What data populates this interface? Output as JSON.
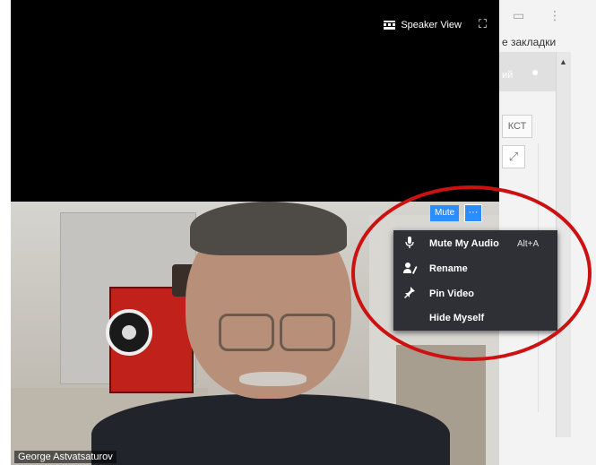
{
  "browser_background": {
    "bookmarks_text": "е закладки",
    "tab_text": "ий",
    "kst_text": "КСТ"
  },
  "top_bar": {
    "speaker_view_label": "Speaker View"
  },
  "video": {
    "participant_name": "George Astvatsaturov",
    "mute_label": "Mute",
    "more_label": "···"
  },
  "context_menu": {
    "items": [
      {
        "label": "Mute My Audio",
        "shortcut": "Alt+A",
        "icon": "microphone-icon"
      },
      {
        "label": "Rename",
        "icon": "rename-icon"
      },
      {
        "label": "Pin Video",
        "icon": "pin-icon"
      },
      {
        "label": "Hide Myself",
        "icon": ""
      }
    ]
  },
  "colors": {
    "accent_blue": "#2d8cff",
    "menu_bg": "#2f3036",
    "annotation_red": "#cc1111"
  }
}
